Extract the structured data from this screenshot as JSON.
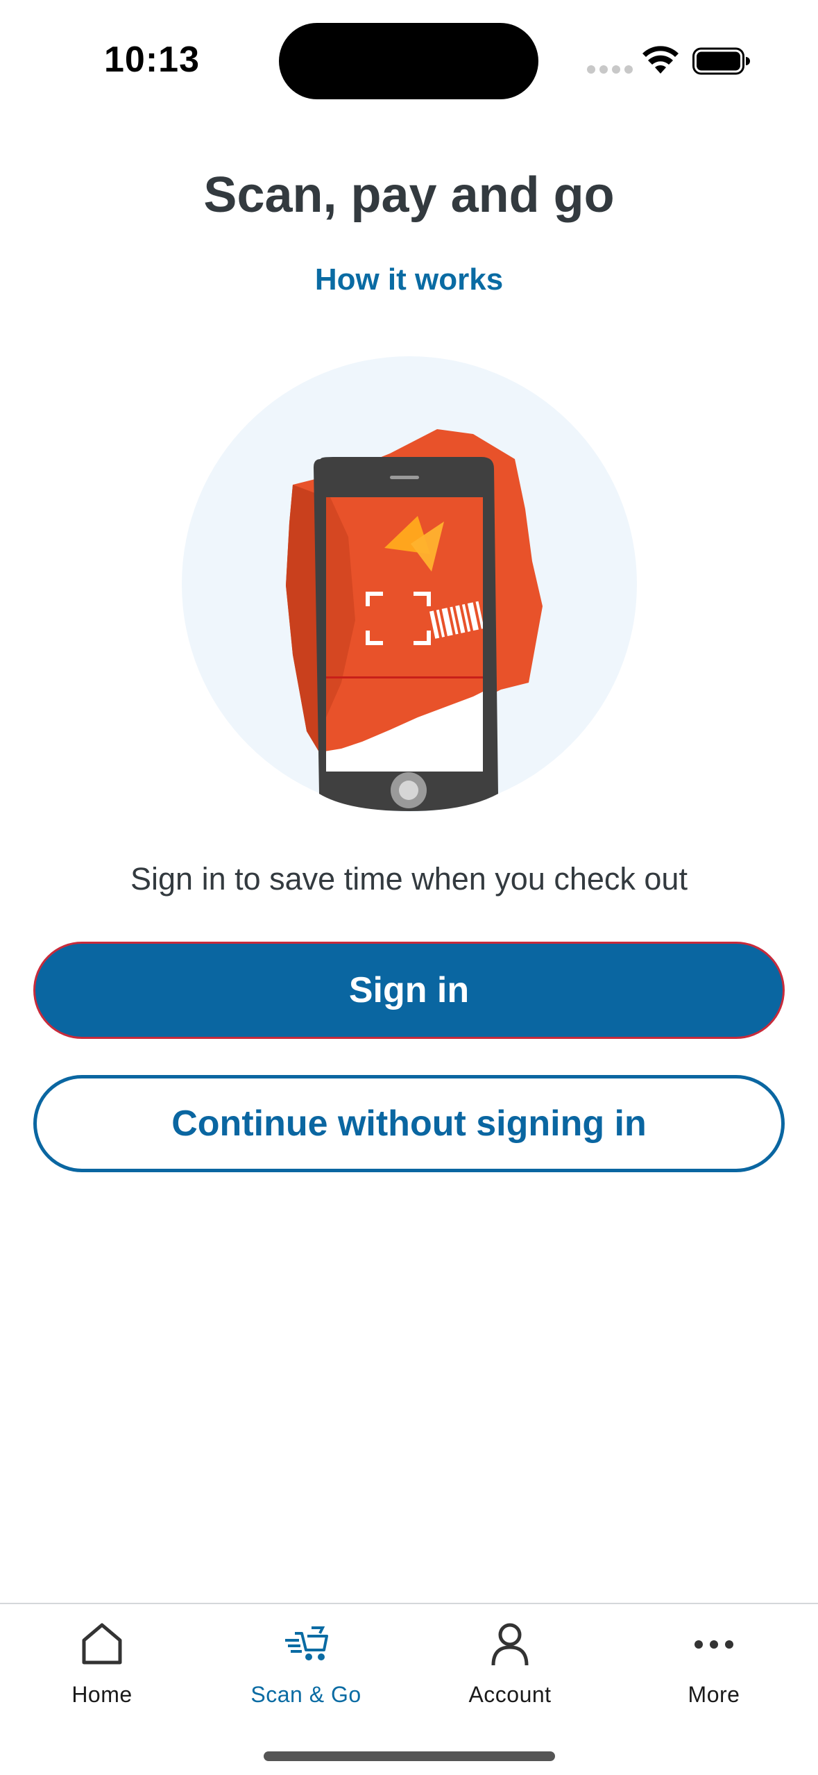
{
  "status_bar": {
    "time": "10:13"
  },
  "main": {
    "title": "Scan, pay and go",
    "how_it_works": "How it works",
    "prompt": "Sign in to save time when you check out",
    "sign_in_label": "Sign in",
    "continue_label": "Continue without signing in"
  },
  "tab_bar": {
    "tabs": [
      {
        "label": "Home",
        "icon": "home-icon",
        "active": false
      },
      {
        "label": "Scan & Go",
        "icon": "cart-icon",
        "active": true
      },
      {
        "label": "Account",
        "icon": "person-icon",
        "active": false
      },
      {
        "label": "More",
        "icon": "more-icon",
        "active": false
      }
    ]
  },
  "colors": {
    "brand_blue": "#0a66a1",
    "text_dark": "#333a3f",
    "illustration_circle": "#eff6fc",
    "illustration_orange": "#e8522a"
  }
}
